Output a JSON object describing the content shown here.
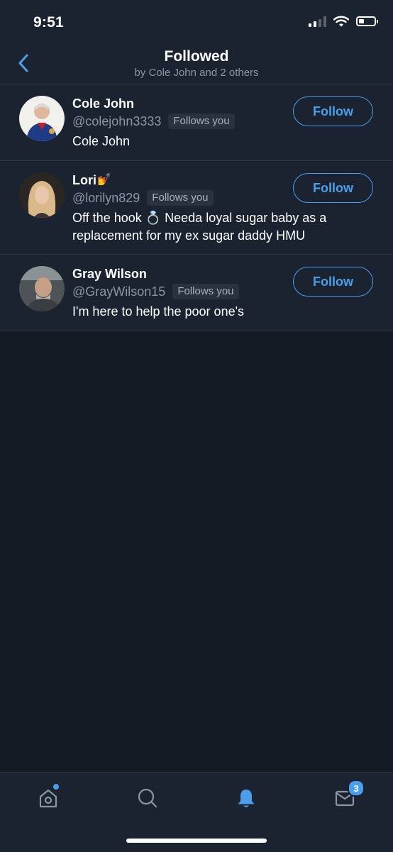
{
  "status_bar": {
    "time": "9:51",
    "battery_level": 0.35
  },
  "header": {
    "title": "Followed",
    "subtitle": "by Cole John and 2 others"
  },
  "users": [
    {
      "name": "Cole John",
      "name_emoji": "",
      "handle": "@colejohn3333",
      "follows_you": "Follows you",
      "bio": "Cole John",
      "button": "Follow"
    },
    {
      "name": "Lori",
      "name_emoji": "💅",
      "handle": "@lorilyn829",
      "follows_you": "Follows you",
      "bio": "Off the hook 💍 Needa loyal sugar baby as a replacement for my ex sugar daddy HMU",
      "button": "Follow"
    },
    {
      "name": "Gray Wilson",
      "name_emoji": "",
      "handle": "@GrayWilson15",
      "follows_you": "Follows you",
      "bio": "I'm here to help the poor one's",
      "button": "Follow"
    }
  ],
  "tab_bar": {
    "messages_badge": "3"
  },
  "colors": {
    "accent": "#4a9eea",
    "background": "#141a24",
    "surface": "#1b2330",
    "secondary_text": "#8a96a3"
  }
}
